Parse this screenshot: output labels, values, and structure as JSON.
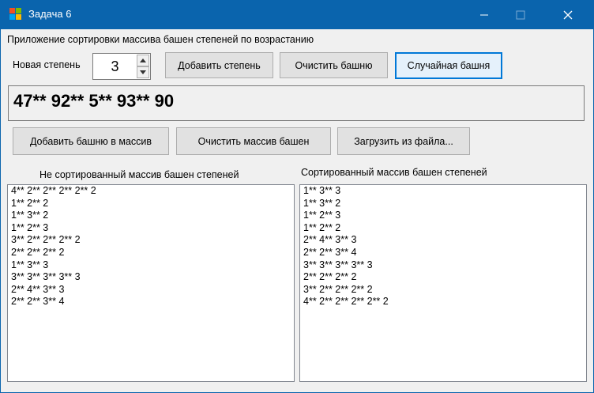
{
  "window": {
    "title": "Задача 6",
    "icon": "app-icon",
    "controls": [
      "minimize-icon",
      "maximize-icon",
      "close-icon"
    ]
  },
  "header_label": "Приложение сортировки массива башен степеней по возрастанию",
  "degree": {
    "label": "Новая степень",
    "value": "3"
  },
  "buttons": {
    "add_degree": "Добавить степень",
    "clear_tower": "Очистить башню",
    "random_tower": "Случайная башня",
    "add_tower": "Добавить башню в массив",
    "clear_array": "Очистить массив башен",
    "load_file": "Загрузить из файла..."
  },
  "tower_display": "47** 92** 5** 93** 90",
  "unsorted": {
    "label": "Не сортированный массив башен степеней",
    "items": [
      "4** 2** 2** 2** 2** 2",
      "1** 2** 2",
      "1** 3** 2",
      "1** 2** 3",
      "3** 2** 2** 2** 2",
      "2** 2** 2** 2",
      "1** 3** 3",
      "3** 3** 3** 3** 3",
      "2** 4** 3** 3",
      "2** 2** 3** 4"
    ]
  },
  "sorted": {
    "label": "Сортированный массив башен степеней",
    "items": [
      "1** 3** 3",
      "1** 3** 2",
      "1** 2** 3",
      "1** 2** 2",
      "2** 4** 3** 3",
      "2** 2** 3** 4",
      "3** 3** 3** 3** 3",
      "2** 2** 2** 2",
      "3** 2** 2** 2** 2",
      "4** 2** 2** 2** 2** 2"
    ]
  },
  "colors": {
    "titlebar": "#0a64ad",
    "window_bg": "#f0f0f0",
    "focus_border": "#0078d7"
  }
}
